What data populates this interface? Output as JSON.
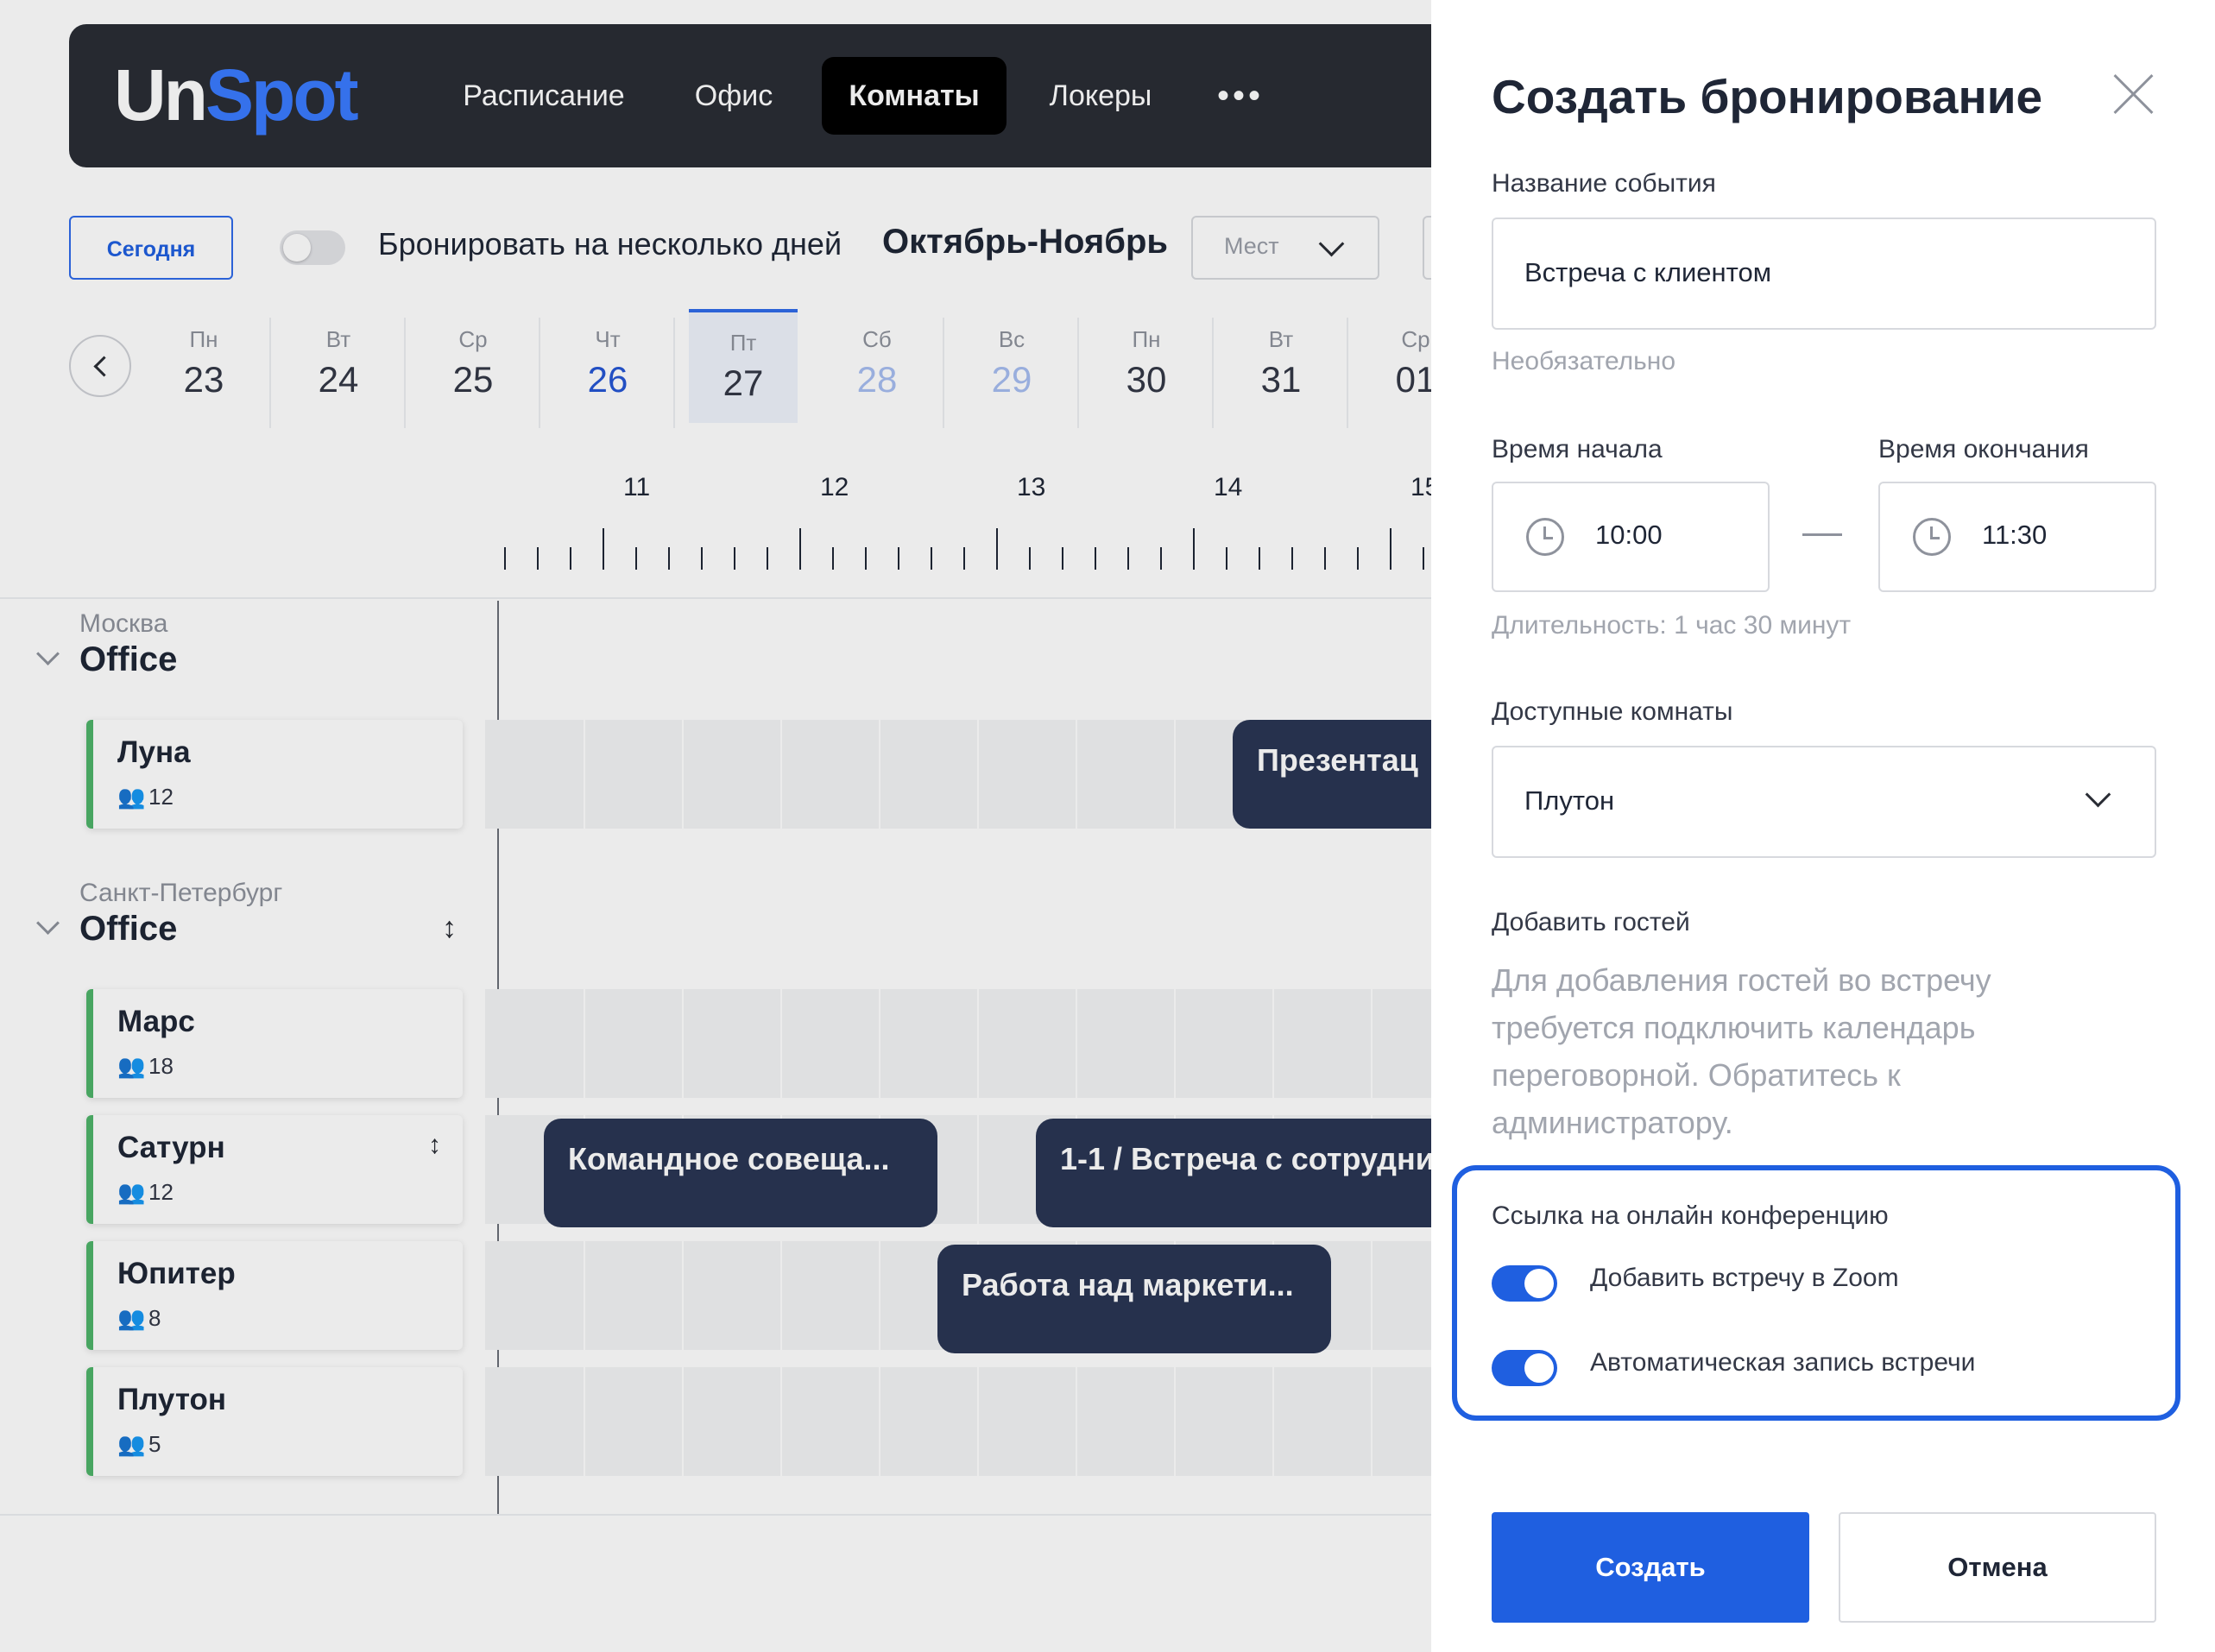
{
  "app": {
    "logo": {
      "part1": "Un",
      "part2": "Spot"
    },
    "nav": [
      {
        "label": "Расписание"
      },
      {
        "label": "Офис"
      },
      {
        "label": "Комнаты"
      },
      {
        "label": "Локеры"
      },
      {
        "label": "•••"
      }
    ],
    "toolbar": {
      "today_label": "Сегодня",
      "multi_day_label": "Бронировать на несколько дней",
      "month_label": "Октябрь-Ноябрь",
      "places_placeholder": "Мест"
    },
    "days": [
      {
        "dn": "Пн",
        "dd": "23"
      },
      {
        "dn": "Вт",
        "dd": "24"
      },
      {
        "dn": "Ср",
        "dd": "25"
      },
      {
        "dn": "Чт",
        "dd": "26"
      },
      {
        "dn": "Пт",
        "dd": "27"
      },
      {
        "dn": "Сб",
        "dd": "28"
      },
      {
        "dn": "Вс",
        "dd": "29"
      },
      {
        "dn": "Пн",
        "dd": "30"
      },
      {
        "dn": "Вт",
        "dd": "31"
      },
      {
        "dn": "Ср",
        "dd": "01"
      }
    ],
    "hours": [
      "11",
      "12",
      "13",
      "14",
      "15"
    ],
    "groups": [
      {
        "city": "Москва",
        "name": "Office"
      },
      {
        "city": "Санкт-Петербург",
        "name": "Office"
      }
    ],
    "rooms": [
      {
        "name": "Луна",
        "capacity": "12"
      },
      {
        "name": "Марс",
        "capacity": "18"
      },
      {
        "name": "Сатурн",
        "capacity": "12"
      },
      {
        "name": "Юпитер",
        "capacity": "8"
      },
      {
        "name": "Плутон",
        "capacity": "5"
      }
    ],
    "events": [
      {
        "title": "Презентац"
      },
      {
        "title": "Командное совеща..."
      },
      {
        "title": "1-1 / Встреча с сотрудни"
      },
      {
        "title": "Работа над маркети..."
      }
    ]
  },
  "panel": {
    "title": "Создать бронирование",
    "event_name_label": "Название события",
    "event_name_value": "Встреча с клиентом",
    "optional_hint": "Необязательно",
    "start_label": "Время начала",
    "start_value": "10:00",
    "end_label": "Время окончания",
    "end_value": "11:30",
    "duration": "Длительность: 1 час 30 минут",
    "rooms_label": "Доступные комнаты",
    "rooms_value": "Плутон",
    "guests_label": "Добавить гостей",
    "guests_hint": "Для добавления гостей во встречу требуется подключить календарь переговорной. Обратитесь к администратору.",
    "conference_label": "Ссылка на онлайн конференцию",
    "zoom_label": "Добавить встречу в Zoom",
    "zoom_enabled": true,
    "record_label": "Автоматическая запись встречи",
    "record_enabled": true,
    "create_button": "Создать",
    "cancel_button": "Отмена"
  },
  "colors": {
    "accent": "#1f5fe0",
    "nav_bg": "#2a2d35",
    "event_bg": "#2a3654",
    "room_marker": "#4fb46a"
  },
  "icons": [
    "close-icon",
    "clock-icon",
    "chevron-down-icon",
    "chevron-left-icon",
    "people-icon",
    "sort-icon"
  ]
}
